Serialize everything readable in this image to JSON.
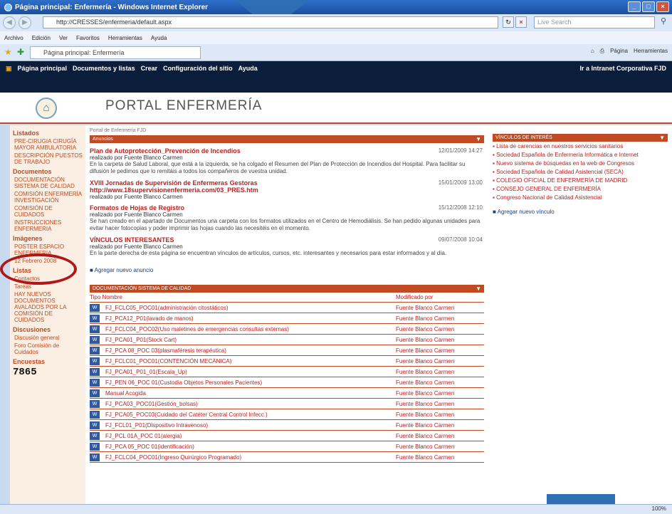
{
  "window": {
    "title": "Página principal: Enfermería - Windows Internet Explorer"
  },
  "browser": {
    "url": "http://CRESSES/enfermeria/default.aspx",
    "search_placeholder": "Live Search",
    "menu": [
      "Archivo",
      "Edición",
      "Ver",
      "Favoritos",
      "Herramientas",
      "Ayuda"
    ],
    "tab_title": "Página principal: Enfermería",
    "tools": [
      "Página",
      "Herramientas"
    ]
  },
  "sharepoint": {
    "menu": [
      "Página principal",
      "Documentos y listas",
      "Crear",
      "Configuración del sitio",
      "Ayuda"
    ],
    "right_link": "Ir a Intranet Corporativa FJD",
    "portal_title": "PORTAL ENFERMERÍA"
  },
  "sidebar": {
    "sections": [
      {
        "heading": "Listados",
        "items": [
          "PRE-CIRUGIA CIRUGÍA MAYOR AMBULATORIA",
          "DESCRIPCIÓN PUESTOS DE TRABAJO"
        ]
      },
      {
        "heading": "Documentos",
        "items": [
          "DOCUMENTACIÓN SISTEMA DE CALIDAD",
          "COMISIÓN ENFERMERÍA INVESTIGACIÓN",
          "COMISIÓN DE CUIDADOS",
          "INSTRUCCIONES ENFERMERIA"
        ]
      },
      {
        "heading": "Imágenes",
        "items": [
          "POSTER ESPACIO ENFERMERIA",
          "12 Febrero 2008"
        ]
      },
      {
        "heading": "Listas",
        "items": [
          "Contactos",
          "Tareas",
          "HAY NUEVOS DOCUMENTOS AVALADOS POR LA COMISIÓN DE CUIDADOS"
        ]
      },
      {
        "heading": "Discusiones",
        "items": [
          "Discusión general",
          "Foro Comisión de Cuidados"
        ]
      },
      {
        "heading": "Encuestas",
        "items": []
      }
    ],
    "counter": "7865"
  },
  "main": {
    "breadcrumb": "Portal de Enfermería FJD",
    "announcements_title": "Anuncios",
    "announcements": [
      {
        "title": "Plan de Autoprotección_Prevención de Incendios",
        "date": "12/01/2009 14:27",
        "by": "realizado por Fuente Blanco Carmen",
        "body": "En la carpeta de Salud Laboral, que está a la izquierda, se ha colgado el Resumen del Plan de Protección de Incendios del Hospital. Para facilitar su difusión le pedimos que lo remitáis a todos los compañeros de vuestra unidad."
      },
      {
        "title": "XVIII Jornadas de Supervisión de Enfermeras Gestoras http://www.18supervisionenfermeria.com/03_PRES.htm",
        "date": "15/01/2009 13:00",
        "by": "realizado por Fuente Blanco Carmen",
        "body": ""
      },
      {
        "title": "Formatos de Hojas de Registro",
        "date": "15/12/2008 12:10",
        "by": "realizado por Fuente Blanco Carmen",
        "body": "Se han creado en el apartado de Documentos una carpeta con los formatos utilizados en el Centro de Hemodiálisis. Se han pedido algunas unidades para evitar hacer fotocopias y poder imprimir las hojas cuando las necesitéis en el momento."
      },
      {
        "title": "VÍNCULOS INTERESANTES",
        "date": "09/07/2008 10:04",
        "by": "realizado por Fuente Blanco Carmen",
        "body": "En la parte derecha de esta página se encuentran vínculos de artículos, cursos, etc. interesantes y necesarios para estar informados y al día."
      }
    ],
    "add_announcement": "Agregar nuevo anuncio",
    "quality_title": "DOCUMENTACIÓN SISTEMA DE CALIDAD",
    "columns": [
      "Tipo",
      "Nombre",
      "Modificado por"
    ],
    "documents": [
      {
        "name": "FJ_FCLC05_POC01(administración citostáticos)",
        "modified_by": "Fuente Blanco Carmen"
      },
      {
        "name": "FJ_PCA12_P01(lavado de manos)",
        "modified_by": "Fuente Blanco Carmen"
      },
      {
        "name": "FJ_FCLC04_POC02(Uso maletines de emergencias consultas externas)",
        "modified_by": "Fuente Blanco Carmen"
      },
      {
        "name": "FJ_PCA01_P01(Stock Cart)",
        "modified_by": "Fuente Blanco Carmen"
      },
      {
        "name": "FJ_PCA 08_POC 03(plasmaféresis terapéutica)",
        "modified_by": "Fuente Blanco Carmen"
      },
      {
        "name": "FJ_FCLC01_POC01(CONTENCIÓN MECÁNICA)",
        "modified_by": "Fuente Blanco Carmen"
      },
      {
        "name": "FJ_PCA01_P01_01(Escala_Up)",
        "modified_by": "Fuente Blanco Carmen"
      },
      {
        "name": "FJ_PEN 06_POC 01(Custodia Objetos Personales Pacientes)",
        "modified_by": "Fuente Blanco Carmen"
      },
      {
        "name": "Manual Acogida",
        "modified_by": "Fuente Blanco Carmen"
      },
      {
        "name": "FJ_PCA03_POC01(Gestión_bolsas)",
        "modified_by": "Fuente Blanco Carmen"
      },
      {
        "name": "FJ_PCA05_POC03(Cuidado del Catéter Central Control Infecc.)",
        "modified_by": "Fuente Blanco Carmen"
      },
      {
        "name": "FJ_FCL01_P01(Dispositivo Intravenoso)",
        "modified_by": "Fuente Blanco Carmen"
      },
      {
        "name": "FJ_PCL 01A_POC 01(alergia)",
        "modified_by": "Fuente Blanco Carmen"
      },
      {
        "name": "FJ_PCA 05_POC 01(identificación)",
        "modified_by": "Fuente Blanco Carmen"
      },
      {
        "name": "FJ_FCLC04_POC01(Ingreso Quirúrgico Programado)",
        "modified_by": "Fuente Blanco Carmen"
      }
    ]
  },
  "links": {
    "title": "VÍNCULOS DE INTERÉS",
    "items": [
      "Lista de carencias en nuestros servicios sanitarios",
      "Sociedad Española de Enfermería Informática e Internet",
      "Nuevo sistema de búsquedas en la web de Congresos",
      "Sociedad Española de Calidad Asistencial (SECA)",
      "COLEGIO OFICIAL DE ENFERMERÍA DE MADRID",
      "CONSEJO GENERAL DE ENFERMERÍA",
      "Congreso Nacional de Calidad Asistencial"
    ],
    "add_link": "Agregar nuevo vínculo"
  },
  "status": {
    "zoom": "100%"
  }
}
